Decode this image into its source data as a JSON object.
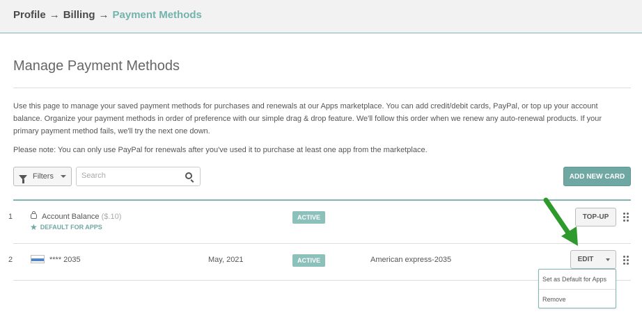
{
  "breadcrumb": {
    "items": [
      "Profile",
      "Billing"
    ],
    "current": "Payment Methods",
    "separator": "→"
  },
  "page": {
    "title": "Manage Payment Methods",
    "description": "Use this page to manage your saved payment methods for purchases and renewals at our Apps marketplace. You can add credit/debit cards, PayPal, or top up your account balance. Organize your payment methods in order of preference with our simple drag & drop feature. We'll follow this order when we renew any auto-renewal products. If your primary payment method fails, we'll try the next one down.",
    "note": "Please note: You can only use PayPal for renewals after you've used it to purchase at least one app from the marketplace."
  },
  "toolbar": {
    "filters_label": "Filters",
    "search_placeholder": "Search",
    "add_card_label": "ADD NEW CARD"
  },
  "rows": [
    {
      "index": "1",
      "name": "Account Balance",
      "amount": "($.10)",
      "default_label": "DEFAULT FOR APPS",
      "status": "ACTIVE",
      "action": "TOP-UP"
    },
    {
      "index": "2",
      "name": "**** 2035",
      "expiry": "May, 2021",
      "status": "ACTIVE",
      "card_label": "American express-2035",
      "action": "EDIT"
    }
  ],
  "dropdown": {
    "options": [
      "Set as Default for Apps",
      "Remove"
    ]
  },
  "colors": {
    "accent": "#6fa7a3",
    "badge": "#8cc0bb",
    "arrow": "#2e9a2e"
  },
  "icons": {
    "filter": "funnel-icon",
    "search": "search-icon",
    "balance": "money-bag-icon",
    "default": "star-icon",
    "card": "amex-card-icon",
    "drag": "drag-handle-icon",
    "caret": "chevron-down-icon",
    "annotation": "arrow-icon"
  }
}
